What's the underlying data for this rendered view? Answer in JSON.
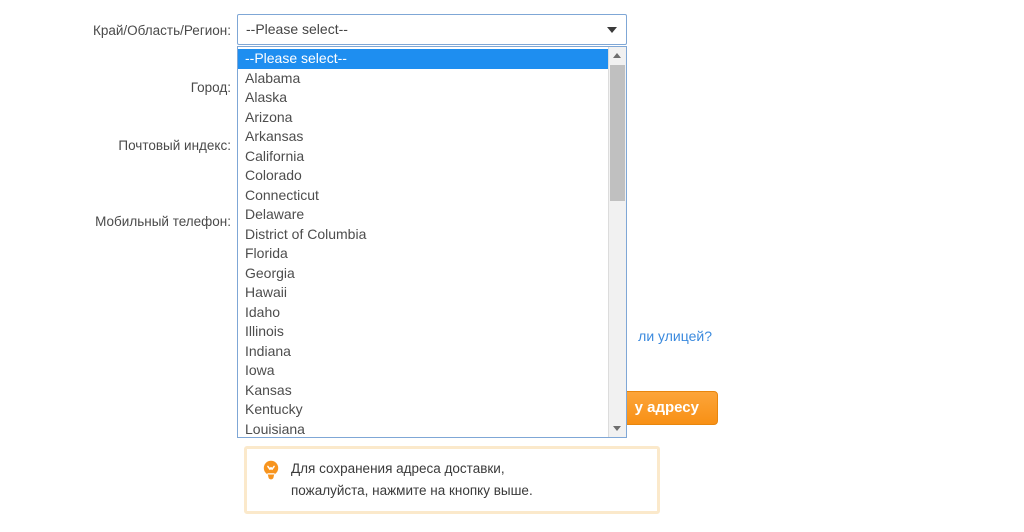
{
  "form": {
    "labels": {
      "region": "Край/Область/Регион:",
      "city": "Город:",
      "zip": "Почтовый индекс:",
      "phone": "Мобильный телефон:"
    },
    "values": {
      "city": "",
      "zip": "",
      "phone": ""
    },
    "placeholders": {
      "city": "",
      "zip": "",
      "phone": ""
    }
  },
  "region_select": {
    "selected_label": "--Please select--",
    "expanded": true,
    "arrow_icon": "chevron-down-icon",
    "options": [
      "--Please select--",
      "Alabama",
      "Alaska",
      "Arizona",
      "Arkansas",
      "California",
      "Colorado",
      "Connecticut",
      "Delaware",
      "District of Columbia",
      "Florida",
      "Georgia",
      "Hawaii",
      "Idaho",
      "Illinois",
      "Indiana",
      "Iowa",
      "Kansas",
      "Kentucky",
      "Louisiana"
    ],
    "highlighted_index": 0,
    "scrollbar": {
      "up_icon": "triangle-up-icon",
      "down_icon": "triangle-down-icon"
    }
  },
  "helper_link": {
    "text": "ли улицей?"
  },
  "save_button": {
    "label": "у адресу"
  },
  "hint": {
    "icon": "lightbulb-icon",
    "text": "Для сохранения адреса доставки,\nпожалуйста, нажмите на кнопку выше."
  },
  "colors": {
    "highlight_blue": "#1e8ef0",
    "link_blue": "#3b8ade",
    "button_orange": "#f89015",
    "hint_border": "#fbe9cb",
    "bulb_orange": "#f7941e",
    "border_blue": "#7fa7d6"
  }
}
